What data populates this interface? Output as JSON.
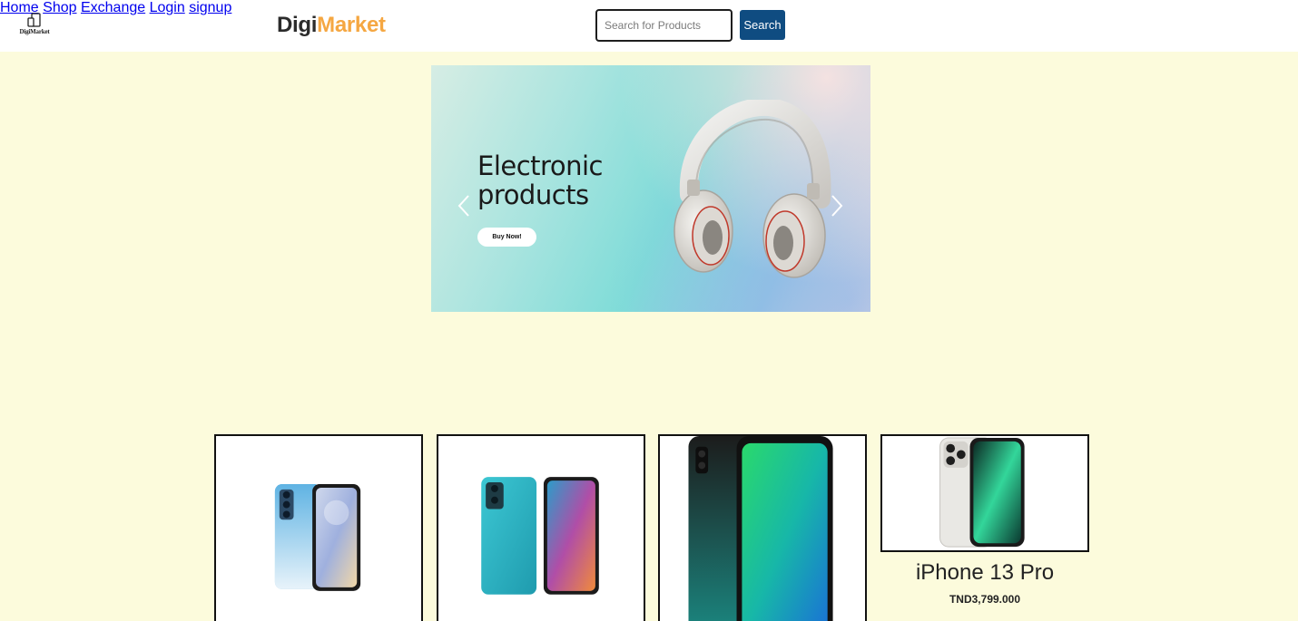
{
  "header": {
    "logo_text": "DigiMarket",
    "brand_part1": "Digi",
    "brand_part2": "Market",
    "brand_accent_color": "#f5a742",
    "search": {
      "placeholder": "Search for Products",
      "value": "",
      "button_label": "Search",
      "button_color": "#0f4c81"
    },
    "nav": [
      {
        "label": "Home"
      },
      {
        "label": "Shop"
      },
      {
        "label": "Exchange"
      },
      {
        "label": "Login"
      },
      {
        "label": "signup"
      }
    ]
  },
  "carousel": {
    "slide_title_line1": "Electronic",
    "slide_title_line2": "products",
    "cta_label": "Buy Now!",
    "prev_icon": "chevron-left-icon",
    "next_icon": "chevron-right-icon",
    "image": "headphones"
  },
  "products": [
    {
      "image": "blue-smartphone",
      "name": "",
      "price": ""
    },
    {
      "image": "teal-smartphone",
      "name": "",
      "price": ""
    },
    {
      "image": "green-smartphone",
      "name": "",
      "price": ""
    },
    {
      "image": "iphone",
      "name": "iPhone 13 Pro",
      "price": "TND3,799.000"
    }
  ],
  "colors": {
    "page_background": "#fcfbdc",
    "header_background": "#ffffff"
  }
}
